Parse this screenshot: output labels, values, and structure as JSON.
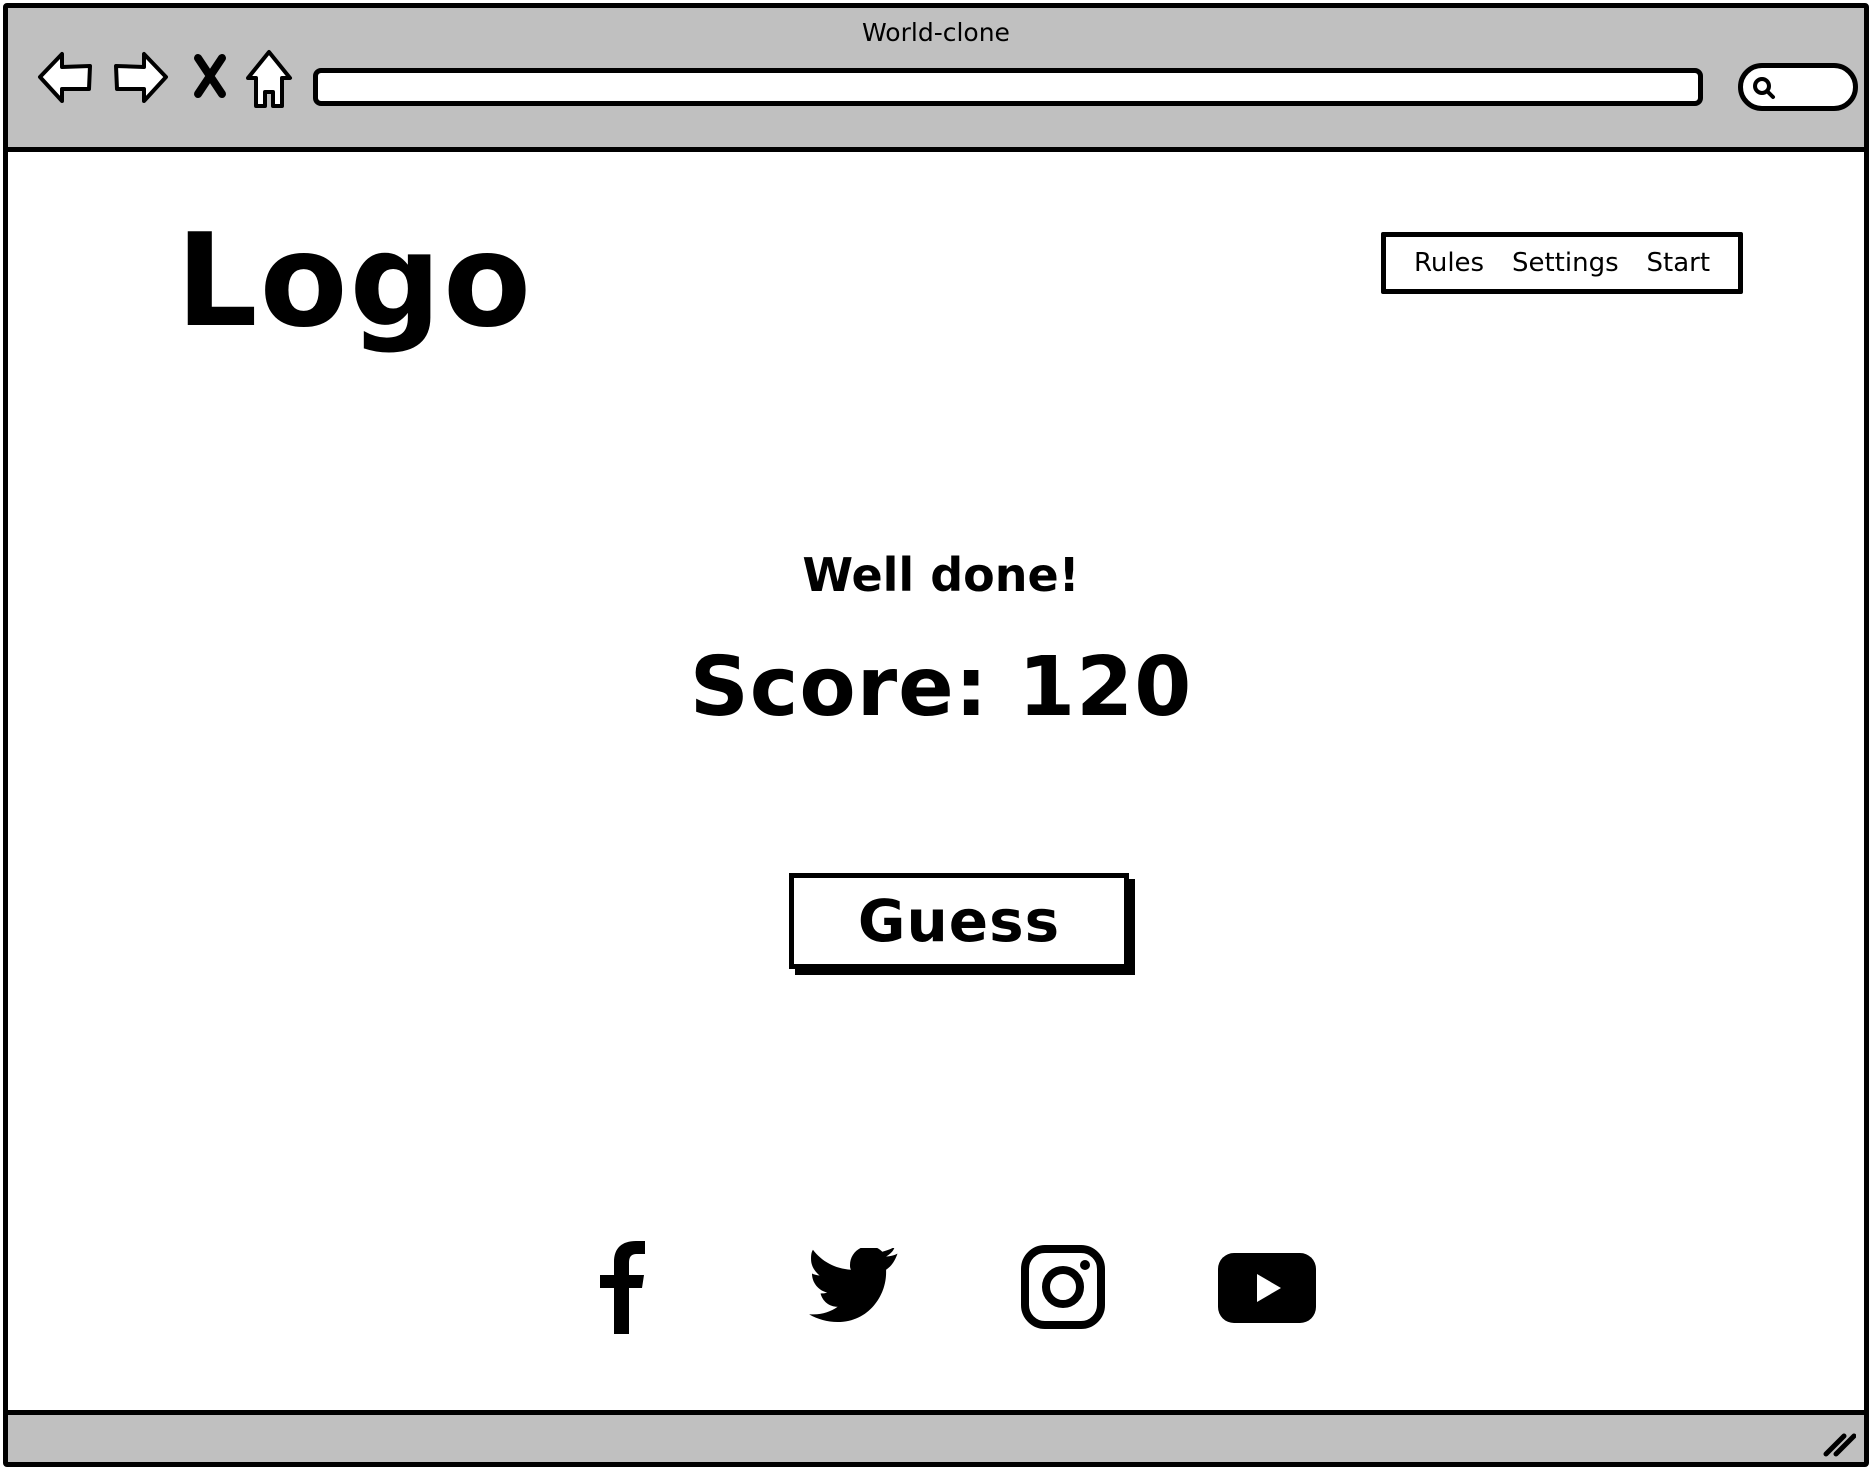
{
  "browser": {
    "title": "World-clone",
    "url": "",
    "search_value": ""
  },
  "header": {
    "logo": "Logo",
    "nav": [
      "Rules",
      "Settings",
      "Start"
    ]
  },
  "main": {
    "message": "Well done!",
    "score_text": "Score: 120",
    "guess_button": "Guess"
  },
  "footer": {
    "social_icons": [
      "facebook-icon",
      "twitter-icon",
      "instagram-icon",
      "youtube-icon"
    ]
  },
  "colors": {
    "chrome": "#c0c0c0",
    "ink": "#000000",
    "page": "#ffffff"
  }
}
